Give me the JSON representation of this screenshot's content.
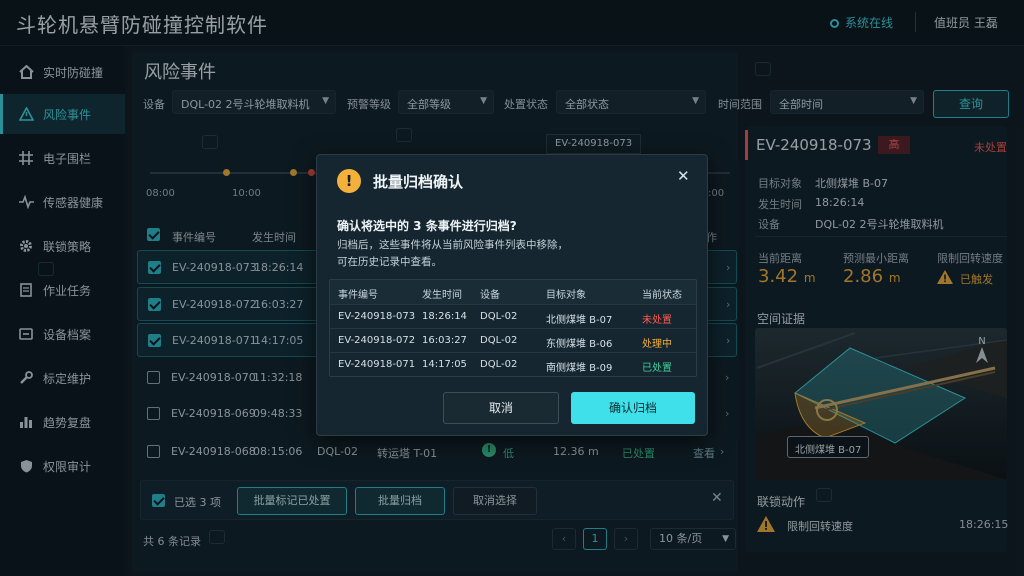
{
  "app": {
    "title": "斗轮机悬臂防碰撞控制软件",
    "status": "系统在线",
    "user": "值班员  王磊"
  },
  "sidebar": {
    "items": [
      {
        "label": "实时防碰撞",
        "icon": "home-icon"
      },
      {
        "label": "风险事件",
        "icon": "warning-icon",
        "active": true
      },
      {
        "label": "电子围栏",
        "icon": "grid-icon"
      },
      {
        "label": "传感器健康",
        "icon": "pulse-icon"
      },
      {
        "label": "联锁策略",
        "icon": "gear-icon"
      },
      {
        "label": "作业任务",
        "icon": "document-icon"
      },
      {
        "label": "设备档案",
        "icon": "archive-icon"
      },
      {
        "label": "标定维护",
        "icon": "wrench-icon"
      },
      {
        "label": "趋势复盘",
        "icon": "bar-chart-icon"
      },
      {
        "label": "权限审计",
        "icon": "shield-icon"
      }
    ]
  },
  "main": {
    "title": "风险事件",
    "filters": {
      "device_label": "设备",
      "device_value": "DQL-02  2号斗轮堆取料机",
      "level_label": "预警等级",
      "level_value": "全部等级",
      "state_label": "处置状态",
      "state_value": "全部状态",
      "time_label": "时间范围",
      "time_value": "全部时间",
      "query": "查询"
    },
    "timeline": {
      "ticks": [
        "08:00",
        "10:00",
        ":00"
      ],
      "hover_tag": "EV-240918-073"
    },
    "table": {
      "headers": [
        "事件编号",
        "发生时间",
        "作"
      ],
      "rows": [
        {
          "id": "EV-240918-073",
          "time": "18:26:14",
          "checked": true
        },
        {
          "id": "EV-240918-072",
          "time": "16:03:27",
          "checked": true
        },
        {
          "id": "EV-240918-071",
          "time": "14:17:05",
          "checked": true
        },
        {
          "id": "EV-240918-070",
          "time": "11:32:18",
          "checked": false
        },
        {
          "id": "EV-240918-069",
          "time": "09:48:33",
          "checked": false
        },
        {
          "id": "EV-240918-068",
          "time": "08:15:06",
          "checked": false,
          "device": "DQL-02",
          "target": "转运塔 T-01",
          "level": "低",
          "distance": "12.36 m",
          "state": "已处置",
          "action": "查看"
        }
      ]
    },
    "batch": {
      "selected": "已选 3 项",
      "mark": "批量标记已处置",
      "archive": "批量归档",
      "cancel": "取消选择"
    },
    "footer": {
      "total": "共 6 条记录",
      "page": "1",
      "page_size": "10 条/页"
    }
  },
  "detail": {
    "id": "EV-240918-073",
    "level": "高",
    "state": "未处置",
    "target_label": "目标对象",
    "target": "北侧煤堆 B-07",
    "time_label": "发生时间",
    "time": "18:26:14",
    "device_label": "设备",
    "device": "DQL-02  2号斗轮堆取料机",
    "dist_label": "当前距离",
    "dist_value": "3.42",
    "dist_unit": "m",
    "min_label": "预测最小距离",
    "min_value": "2.86",
    "min_unit": "m",
    "limit_label": "限制回转速度",
    "limit_value": "已触发",
    "evidence_label": "空间证据",
    "map_tag": "北侧煤堆 B-07",
    "north": "N",
    "action_label": "联锁动作",
    "action_text": "限制回转速度",
    "action_time": "18:26:15"
  },
  "modal": {
    "title": "批量归档确认",
    "question": "确认将选中的 3 条事件进行归档?",
    "desc1": "归档后，这些事件将从当前风险事件列表中移除，",
    "desc2": "可在历史记录中查看。",
    "headers": [
      "事件编号",
      "发生时间",
      "设备",
      "目标对象",
      "当前状态"
    ],
    "rows": [
      {
        "id": "EV-240918-073",
        "time": "18:26:14",
        "device": "DQL-02",
        "target": "北侧煤堆 B-07",
        "state": "未处置",
        "color": "#ff5a4f"
      },
      {
        "id": "EV-240918-072",
        "time": "16:03:27",
        "device": "DQL-02",
        "target": "东侧煤堆 B-06",
        "state": "处理中",
        "color": "#f3b13c"
      },
      {
        "id": "EV-240918-071",
        "time": "14:17:05",
        "device": "DQL-02",
        "target": "南侧煤堆 B-09",
        "state": "已处置",
        "color": "#3ed29a"
      }
    ],
    "cancel": "取消",
    "confirm": "确认归档"
  },
  "colors": {
    "accent": "#3fd8e0",
    "danger": "#ff5a4f",
    "warning": "#f3b13c",
    "ok": "#3ed29a"
  }
}
